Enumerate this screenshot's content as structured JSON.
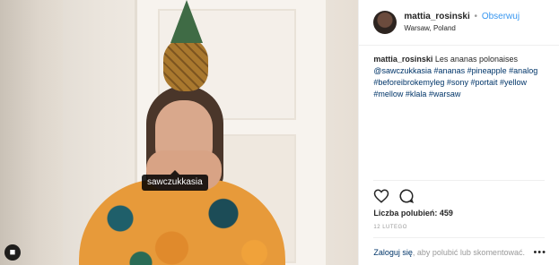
{
  "photo": {
    "tag_label": "sawczukkasia"
  },
  "header": {
    "username": "mattia_rosinski",
    "separator": "•",
    "follow_label": "Obserwuj",
    "location": "Warsaw, Poland"
  },
  "caption": {
    "username": "mattia_rosinski",
    "text": "Les ananas polonaises",
    "tags": [
      "@sawczukkasia",
      "#ananas",
      "#pineapple",
      "#analog",
      "#beforeibrokemyleg",
      "#sony",
      "#portait",
      "#yellow",
      "#mellow",
      "#klala",
      "#warsaw"
    ]
  },
  "actions": {
    "like_icon": "heart-icon",
    "comment_icon": "speech-bubble-icon"
  },
  "likes": {
    "text": "Liczba polubień: 459"
  },
  "date": {
    "text": "12 LUTEGO"
  },
  "footer": {
    "login_link": "Zaloguj się",
    "login_rest": ", aby polubić lub skomentować.",
    "more_label": "•••"
  },
  "colors": {
    "accent": "#3897f0",
    "link": "#003569",
    "muted": "#999999"
  }
}
